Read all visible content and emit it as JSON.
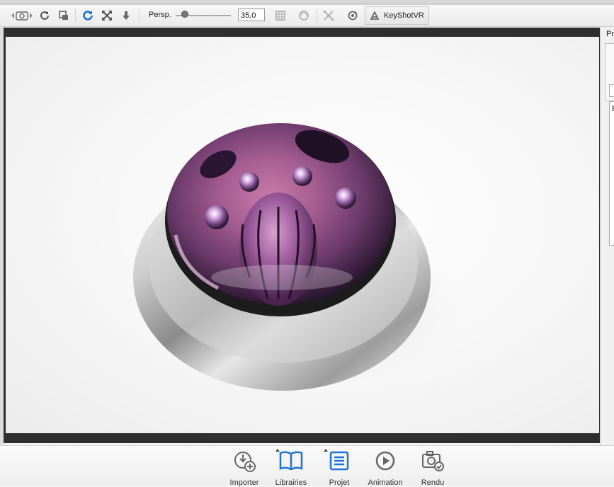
{
  "toolbar": {
    "perspective_label": "Persp.",
    "perspective_value": "35,0",
    "perspective_fraction": 0.15,
    "keyshotvr_label": "KeyShotVR"
  },
  "right_panel": {
    "title_fragment": "Pr",
    "list_fragment": "E"
  },
  "bottom_bar": {
    "import_label": "Importer",
    "libraries_label": "Librairies",
    "project_label": "Projet",
    "animation_label": "Animation",
    "render_label": "Rendu"
  },
  "colors": {
    "accent_blue": "#1e73d6",
    "viewport_border": "#2e2e2e"
  }
}
